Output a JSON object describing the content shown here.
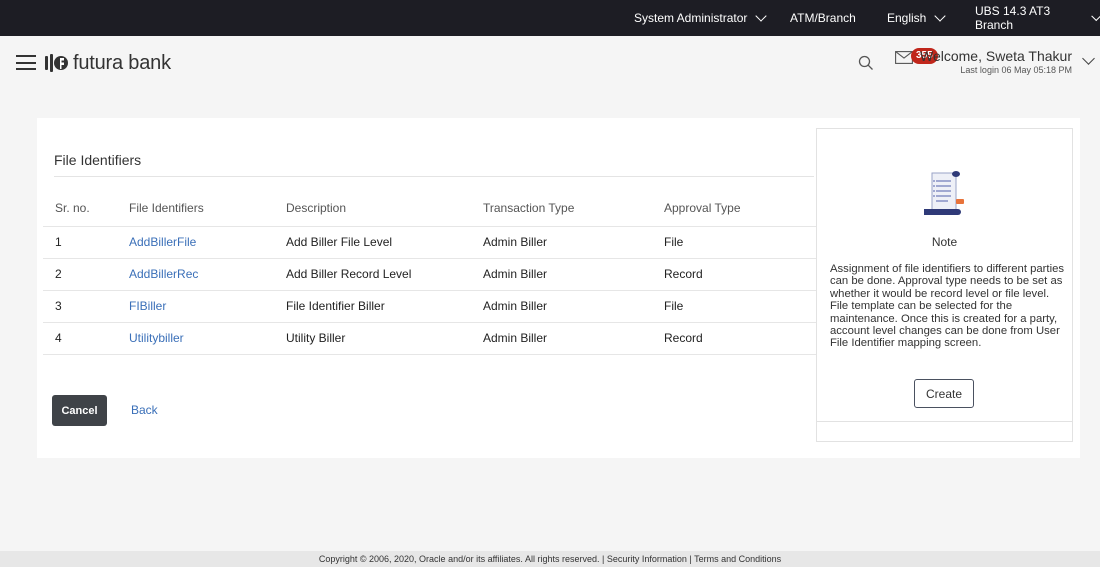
{
  "topbar": {
    "role": "System Administrator",
    "atm_branch": "ATM/Branch",
    "language": "English",
    "branch": "UBS 14.3 AT3 Branch"
  },
  "header": {
    "brand": "futura bank",
    "notification_count": "355",
    "welcome": "Welcome, Sweta Thakur",
    "last_login": "Last login 06 May 05:18 PM"
  },
  "main": {
    "title": "File Identifiers",
    "columns": [
      "Sr. no.",
      "File Identifiers",
      "Description",
      "Transaction Type",
      "Approval Type"
    ],
    "rows": [
      {
        "sr": "1",
        "identifier": "AddBillerFile",
        "description": "Add Biller File Level",
        "transaction_type": "Admin Biller",
        "approval_type": "File"
      },
      {
        "sr": "2",
        "identifier": "AddBillerRec",
        "description": "Add Biller Record Level",
        "transaction_type": "Admin Biller",
        "approval_type": "Record"
      },
      {
        "sr": "3",
        "identifier": "FIBiller",
        "description": "File Identifier Biller",
        "transaction_type": "Admin Biller",
        "approval_type": "File"
      },
      {
        "sr": "4",
        "identifier": "Utilitybiller",
        "description": "Utility Biller",
        "transaction_type": "Admin Biller",
        "approval_type": "Record"
      }
    ],
    "cancel_label": "Cancel",
    "back_label": "Back"
  },
  "note": {
    "title": "Note",
    "text": "Assignment of file identifiers to different parties can be done. Approval type needs to be set as whether it would be record level or file level. File template can be selected for the maintenance. Once this is created for a party, account level changes can be done from User File Identifier mapping screen.",
    "create_label": "Create"
  },
  "footer": {
    "copyright": "Copyright © 2006, 2020, Oracle and/or its affiliates. All rights reserved.",
    "security": "Security Information",
    "terms": "Terms and Conditions"
  },
  "colors": {
    "topbar_bg": "#1d1d24",
    "link": "#3a6fb8",
    "badge": "#c0261b",
    "cancel_bg": "#3f4348"
  }
}
